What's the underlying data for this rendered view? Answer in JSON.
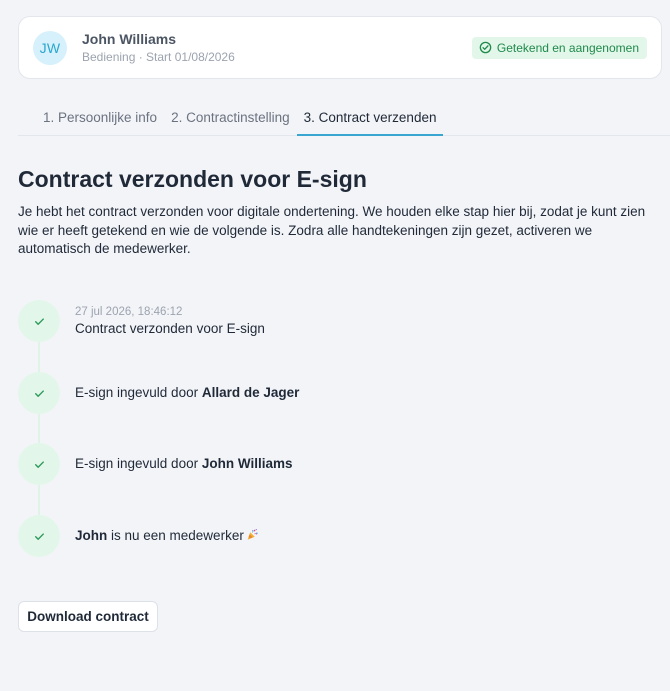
{
  "header": {
    "avatar_initials": "JW",
    "name": "John Williams",
    "subtitle": "Bediening · Start 01/08/2026",
    "status_badge": "Getekend en aangenomen"
  },
  "tabs": [
    {
      "label": "1. Persoonlijke info",
      "active": false
    },
    {
      "label": "2. Contractinstelling",
      "active": false
    },
    {
      "label": "3. Contract verzenden",
      "active": true
    }
  ],
  "main": {
    "title": "Contract verzonden voor E-sign",
    "description": "Je hebt het contract verzonden voor digitale ondertening. We houden elke stap hier bij, zodat je kunt zien wie er heeft getekend en wie de volgende is. Zodra alle handtekeningen zijn gezet, activeren we automatisch de medewerker."
  },
  "timeline": [
    {
      "timestamp": "27 jul 2026, 18:46:12",
      "text": "Contract verzonden voor E-sign"
    },
    {
      "prefix": "E-sign ingevuld door ",
      "bold": "Allard de Jager"
    },
    {
      "prefix": "E-sign ingevuld door ",
      "bold": "John Williams"
    },
    {
      "bold": "John",
      "suffix": " is nu een medewerker",
      "icon": "party-popper-icon"
    }
  ],
  "actions": {
    "download_label": "Download contract"
  },
  "colors": {
    "accent": "#38a6d0",
    "success": "#1f8a4b",
    "success_bg": "#e3f6ea",
    "avatar_bg": "#d6f1fb"
  }
}
